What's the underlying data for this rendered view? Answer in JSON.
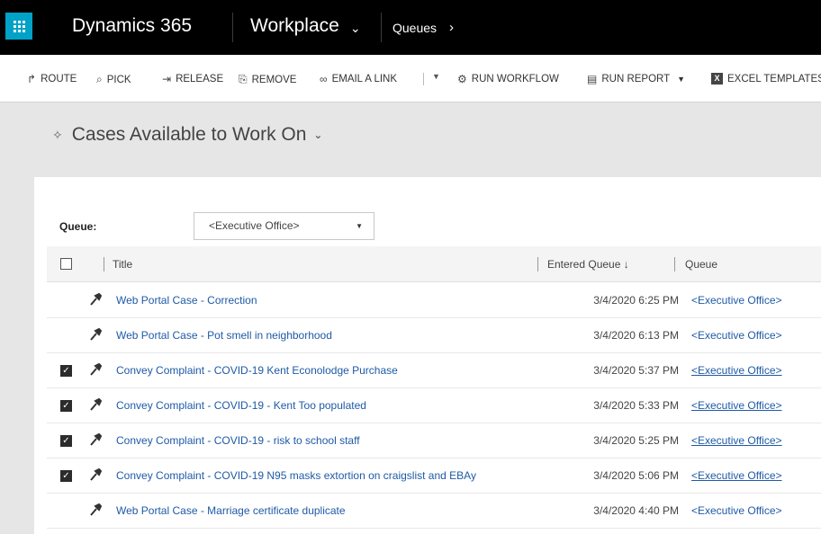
{
  "topnav": {
    "app_name": "Dynamics 365",
    "area": "Workplace",
    "area_chevron": "⌄",
    "entity": "Queues",
    "entity_arrow": "›"
  },
  "commands": [
    {
      "label": "ROUTE",
      "icon": "route-icon",
      "glyph": "↱"
    },
    {
      "label": "PICK",
      "icon": "pick-icon",
      "glyph": "⌕"
    },
    {
      "label": "RELEASE",
      "icon": "release-icon",
      "glyph": "⇥"
    },
    {
      "label": "REMOVE",
      "icon": "remove-icon",
      "glyph": "⎘"
    },
    {
      "label": "EMAIL A LINK",
      "icon": "link-icon",
      "glyph": "∞"
    },
    {
      "label": "RUN WORKFLOW",
      "icon": "workflow-icon",
      "glyph": "⚙"
    },
    {
      "label": "RUN REPORT",
      "icon": "report-icon",
      "glyph": "▤"
    },
    {
      "label": "EXCEL TEMPLATES",
      "icon": "excel-icon",
      "glyph": "X"
    }
  ],
  "view": {
    "title": "Cases Available to Work On",
    "pin_glyph": "✧",
    "chevron": "⌄"
  },
  "queue_filter": {
    "label": "Queue:",
    "value": "<Executive Office>"
  },
  "grid": {
    "columns": [
      "Title",
      "Entered Queue ↓",
      "Queue"
    ],
    "rows": [
      {
        "title": "Web Portal Case - Correction",
        "entered": "3/4/2020 6:25 PM",
        "queue": "<Executive Office>",
        "checked": false
      },
      {
        "title": "Web Portal Case - Pot smell in neighborhood",
        "entered": "3/4/2020 6:13 PM",
        "queue": "<Executive Office>",
        "checked": false
      },
      {
        "title": "Convey Complaint - COVID-19 Kent Econolodge Purchase",
        "entered": "3/4/2020 5:37 PM",
        "queue": "<Executive Office>",
        "checked": true
      },
      {
        "title": "Convey Complaint - COVID-19 - Kent Too populated",
        "entered": "3/4/2020 5:33 PM",
        "queue": "<Executive Office>",
        "checked": true
      },
      {
        "title": "Convey Complaint - COVID-19 - risk to school staff",
        "entered": "3/4/2020 5:25 PM",
        "queue": "<Executive Office>",
        "checked": true
      },
      {
        "title": "Convey Complaint - COVID-19 N95 masks extortion on craigslist and EBAy",
        "entered": "3/4/2020 5:06 PM",
        "queue": "<Executive Office>",
        "checked": true
      },
      {
        "title": "Web Portal Case - Marriage certificate duplicate",
        "entered": "3/4/2020 4:40 PM",
        "queue": "<Executive Office>",
        "checked": false
      }
    ]
  },
  "colors": {
    "nav_bg": "#000000",
    "waffle": "#00a2c7",
    "link": "#1f5aa6"
  }
}
